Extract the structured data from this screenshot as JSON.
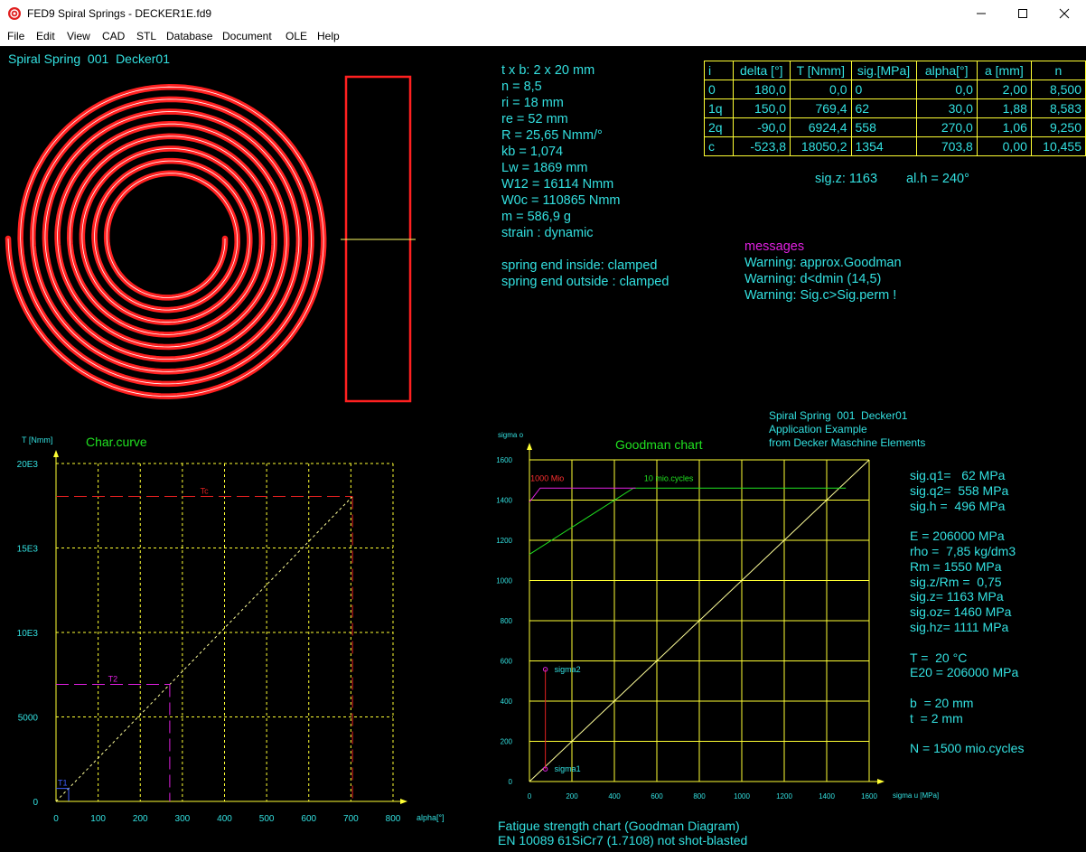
{
  "window": {
    "title": "FED9  Spiral Springs  -  DECKER1E.fd9",
    "controls": [
      "minimize",
      "maximize",
      "close"
    ]
  },
  "menu": [
    "File",
    "Edit",
    "View",
    "CAD",
    "STL",
    "Database",
    "Document",
    "OLE",
    "Help"
  ],
  "menu_accelerators": [
    "F",
    "E",
    "V",
    "C",
    "S",
    "D",
    "D",
    "O",
    "H"
  ],
  "header_title": "Spiral Spring  001  Decker01",
  "params": [
    "t x b: 2 x 20 mm",
    "n = 8,5",
    "ri = 18 mm",
    "re = 52 mm",
    "R = 25,65 Nmm/°",
    "kb = 1,074",
    "Lw = 1869 mm",
    "W12 = 16114 Nmm",
    "W0c = 110865 Nmm",
    "m = 586,9 g",
    "strain : dynamic",
    "",
    "spring end inside: clamped",
    "spring end outside : clamped"
  ],
  "table": {
    "headers": [
      "i",
      "delta [°]",
      "T [Nmm]",
      "sig.[MPa]",
      "alpha[°]",
      "a [mm]",
      "n"
    ],
    "rows": [
      [
        "0",
        "180,0",
        "0,0",
        "0",
        "0,0",
        "2,00",
        "8,500"
      ],
      [
        "1q",
        "150,0",
        "769,4",
        "62",
        "30,0",
        "1,88",
        "8,583"
      ],
      [
        "2q",
        "-90,0",
        "6924,4",
        "558",
        "270,0",
        "1,06",
        "9,250"
      ],
      [
        "c",
        "-523,8",
        "18050,2",
        "1354",
        "703,8",
        "0,00",
        "10,455"
      ]
    ]
  },
  "sig_z_line": "sig.z: 1163",
  "al_h_line": "al.h = 240°",
  "messages": {
    "title": "messages",
    "items": [
      "Warning: approx.Goodman",
      "Warning: d<dmin (14,5)",
      "Warning: Sig.c>Sig.perm !"
    ]
  },
  "goodman_info": [
    "Spiral Spring  001  Decker01",
    "Application Example",
    "from Decker Maschine Elements"
  ],
  "right_params": [
    "sig.q1=   62 MPa",
    "sig.q2=  558 MPa",
    "sig.h =  496 MPa",
    "",
    "E = 206000 MPa",
    "rho =  7,85 kg/dm3",
    "Rm = 1550 MPa",
    "sig.z/Rm =  0,75",
    "sig.z= 1163 MPa",
    "sig.oz= 1460 MPa",
    "sig.hz= 1111 MPa",
    "",
    "T =  20 °C",
    "E20 = 206000 MPa",
    "",
    "b  = 20 mm",
    "t  = 2 mm",
    "",
    "N = 1500 mio.cycles"
  ],
  "footer": [
    "Fatigue strength chart (Goodman Diagram)",
    "EN 10089 61SiCr7 (1.7108) not shot-blasted"
  ],
  "colors": {
    "text": "#33e0e0",
    "grid": "#ffff33",
    "spring": "#ff2020",
    "magenta": "#e020e0",
    "green": "#20e020",
    "background": "#000000"
  },
  "chart_data": [
    {
      "type": "line",
      "title": "Char.curve",
      "ylabel": "T [Nmm]",
      "xlabel": "alpha[°]",
      "xlim": [
        0,
        800
      ],
      "ylim": [
        0,
        20000
      ],
      "x_ticks": [
        0,
        100,
        200,
        300,
        400,
        500,
        600,
        700,
        800
      ],
      "x_tick_labels": [
        "0",
        "100",
        "200",
        "300",
        "400",
        "500",
        "600",
        "700",
        "800"
      ],
      "y_ticks": [
        0,
        5000,
        10000,
        15000,
        20000
      ],
      "y_tick_labels": [
        "0",
        "5000",
        "10E3",
        "15E3",
        "20E3"
      ],
      "grid": true,
      "series": [
        {
          "kind": "characteristic",
          "points": [
            [
              0,
              0
            ],
            [
              703.8,
              18050
            ]
          ]
        }
      ],
      "markers": [
        {
          "name": "T1",
          "alpha": 30,
          "T": 769
        },
        {
          "name": "T2",
          "alpha": 270,
          "T": 6924
        },
        {
          "name": "Tc",
          "alpha": 703.8,
          "T": 18050
        }
      ]
    },
    {
      "type": "line",
      "title": "Goodman chart",
      "ylabel": "sigma o",
      "xlabel": "sigma u [MPa]",
      "xlim": [
        0,
        1600
      ],
      "ylim": [
        0,
        1600
      ],
      "x_ticks": [
        0,
        200,
        400,
        600,
        800,
        1000,
        1200,
        1400,
        1600
      ],
      "x_tick_labels": [
        "0",
        "200",
        "400",
        "600",
        "800",
        "1000",
        "1200",
        "1400",
        "1600"
      ],
      "y_ticks": [
        0,
        200,
        400,
        600,
        800,
        1000,
        1200,
        1400,
        1600
      ],
      "y_tick_labels": [
        "0",
        "200",
        "400",
        "600",
        "800",
        "1000",
        "1200",
        "1400",
        "1600"
      ],
      "grid": true,
      "series": [
        {
          "name": "10 mio.cycles",
          "points": [
            [
              0,
              1130
            ],
            [
              490,
              1460
            ],
            [
              1490,
              1460
            ]
          ]
        },
        {
          "name": "1000 Mio",
          "points": [
            [
              0,
              1390
            ],
            [
              50,
              1460
            ],
            [
              500,
              1460
            ]
          ]
        },
        {
          "kind": "diagonal",
          "points": [
            [
              0,
              0
            ],
            [
              1600,
              1600
            ]
          ]
        }
      ],
      "points": [
        {
          "name": "sigma1",
          "x": 75,
          "y": 62
        },
        {
          "name": "sigma2",
          "x": 75,
          "y": 558
        }
      ]
    }
  ]
}
